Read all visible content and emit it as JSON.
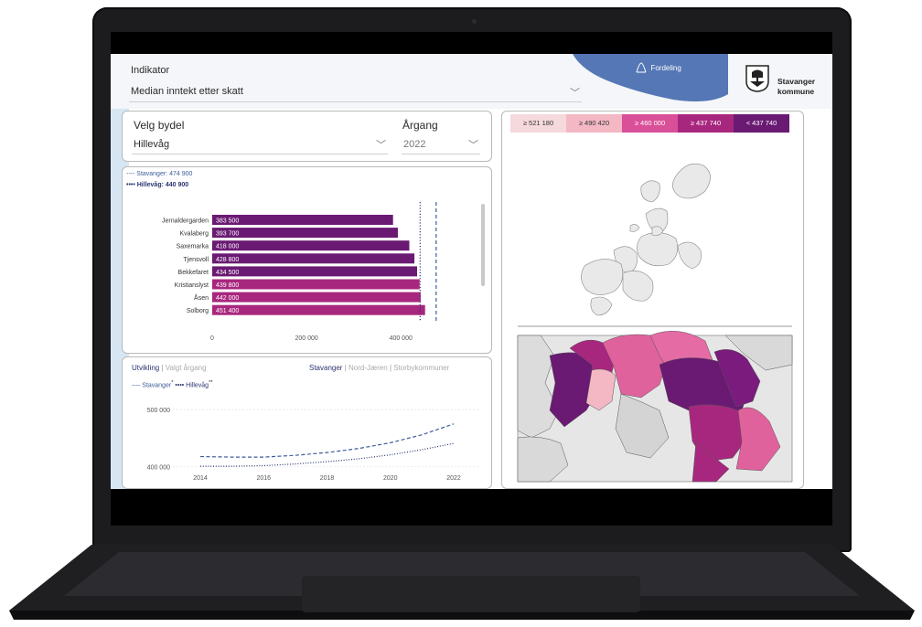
{
  "indikator": {
    "label": "Indikator",
    "value": "Median inntekt etter skatt"
  },
  "fordeling": {
    "label": "Fordeling"
  },
  "brand": {
    "line1": "Stavanger",
    "line2": "kommune"
  },
  "filters": {
    "bydel_label": "Velg bydel",
    "bydel_value": "Hillevåg",
    "year_label": "Årgang",
    "year_value": "2022"
  },
  "map_legend": [
    {
      "label": "≥ 521 180",
      "color": "#f6d9dc"
    },
    {
      "label": "≥ 490 420",
      "color": "#f3b8c4"
    },
    {
      "label": "≥ 460 000",
      "color": "#d94f98"
    },
    {
      "label": "≥ 437 740",
      "color": "#a8277e"
    },
    {
      "label": "< 437 740",
      "color": "#6a1a73"
    }
  ],
  "bar_legend": {
    "stavanger": "---- Stavanger: 474 900",
    "hillevag": "•••• Hillevåg: 440 900"
  },
  "chart_data": [
    {
      "type": "bar",
      "orientation": "horizontal",
      "categories": [
        "Jernaldergarden",
        "Kvalaberg",
        "Saxemarka",
        "Tjensvoll",
        "Bekkefaret",
        "Kristianslyst",
        "Åsen",
        "Solborg"
      ],
      "values": [
        383500,
        393700,
        418000,
        428800,
        434500,
        439800,
        442000,
        451400
      ],
      "value_labels": [
        "383 500",
        "393 700",
        "418 000",
        "428 800",
        "434 500",
        "439 800",
        "442 000",
        "451 400"
      ],
      "bar_colors": [
        "#6a1a73",
        "#6a1a73",
        "#6a1a73",
        "#6a1a73",
        "#6a1a73",
        "#a8277e",
        "#a8277e",
        "#a8277e"
      ],
      "xlim": [
        0,
        450000
      ],
      "xticks": [
        0,
        200000,
        400000
      ],
      "xtick_labels": [
        "0",
        "200 000",
        "400 000"
      ],
      "reference_lines": [
        {
          "value": 440900,
          "style": "dotted"
        },
        {
          "value": 474900,
          "style": "dashed"
        }
      ]
    },
    {
      "type": "line",
      "x": [
        2014,
        2016,
        2018,
        2020,
        2022
      ],
      "xtick_labels": [
        "2014",
        "2016",
        "2018",
        "2020",
        "2022"
      ],
      "ylim": [
        390000,
        505000
      ],
      "yticks": [
        400000,
        500000
      ],
      "ytick_labels": [
        "400 000",
        "500 000"
      ],
      "series": [
        {
          "name": "Stavanger*",
          "style": "dashed",
          "color": "#3d5c99",
          "points": [
            [
              2014,
              418000
            ],
            [
              2015,
              417000
            ],
            [
              2016,
              417000
            ],
            [
              2017,
              420000
            ],
            [
              2018,
              425000
            ],
            [
              2019,
              432000
            ],
            [
              2020,
              442000
            ],
            [
              2021,
              456000
            ],
            [
              2022,
              475000
            ]
          ]
        },
        {
          "name": "Hillevåg**",
          "style": "dotted",
          "color": "#2a3470",
          "points": [
            [
              2014,
              401000
            ],
            [
              2015,
              401000
            ],
            [
              2016,
              402000
            ],
            [
              2017,
              405000
            ],
            [
              2018,
              409000
            ],
            [
              2019,
              414000
            ],
            [
              2020,
              421000
            ],
            [
              2021,
              430000
            ],
            [
              2022,
              441000
            ]
          ]
        }
      ]
    }
  ],
  "dev_tabs": {
    "utvikling": "Utvikling",
    "valgt": "Valgt årgang",
    "stavanger": "Stavanger",
    "nordjaeren": "Nord-Jæren",
    "storby": "Storbykommuner",
    "sep": "|"
  },
  "dev_legend": {
    "stavanger": "---- Stavanger",
    "stavanger_sup": "*",
    "hillevag": " •••• Hillevåg",
    "hillevag_sup": "**"
  }
}
